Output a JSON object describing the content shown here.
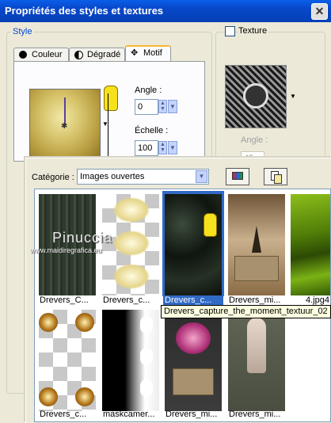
{
  "window": {
    "title": "Propriétés des styles et textures",
    "close_symbol": "✕"
  },
  "style_group": {
    "legend": "Style"
  },
  "tabs": [
    {
      "label": "Couleur",
      "icon": "circle-icon"
    },
    {
      "label": "Dégradé",
      "icon": "gradient-icon"
    },
    {
      "label": "Motif",
      "icon": "pattern-icon",
      "active": true
    }
  ],
  "pattern_controls": {
    "angle_label": "Angle :",
    "angle_value": "0",
    "scale_label": "Échelle :",
    "scale_value": "100"
  },
  "texture_group": {
    "checkbox_label": "Texture",
    "checked": false,
    "angle_label": "Angle :",
    "angle_value": "45"
  },
  "popup": {
    "category_label": "Catégorie :",
    "category_value": "Images ouvertes"
  },
  "watermark": {
    "name": "Pinuccia",
    "url": "www.maidiregrafica.eu"
  },
  "thumbnails": [
    {
      "name": "Drevers_C...",
      "kind": "dark-green"
    },
    {
      "name": "Drevers_c...",
      "kind": "gold-mask"
    },
    {
      "name": "Drevers_c...",
      "kind": "dark-texture",
      "selected": true
    },
    {
      "name": "Drevers_mi...",
      "kind": "eiffel-card"
    },
    {
      "name": "4.jpg4",
      "kind": "green-grass"
    },
    {
      "name": "Drevers_c...",
      "kind": "brown-dots"
    },
    {
      "name": "maskcamer...",
      "kind": "black-mask"
    },
    {
      "name": "Drevers_mi...",
      "kind": "flowers-card"
    },
    {
      "name": "Drevers_mi...",
      "kind": "woman-card"
    }
  ],
  "tooltip": "Drevers_capture_the_moment_textuur_02",
  "colors": {
    "accent": "#0a5ee7",
    "selection": "#316ac5",
    "legend": "#0046d5"
  }
}
